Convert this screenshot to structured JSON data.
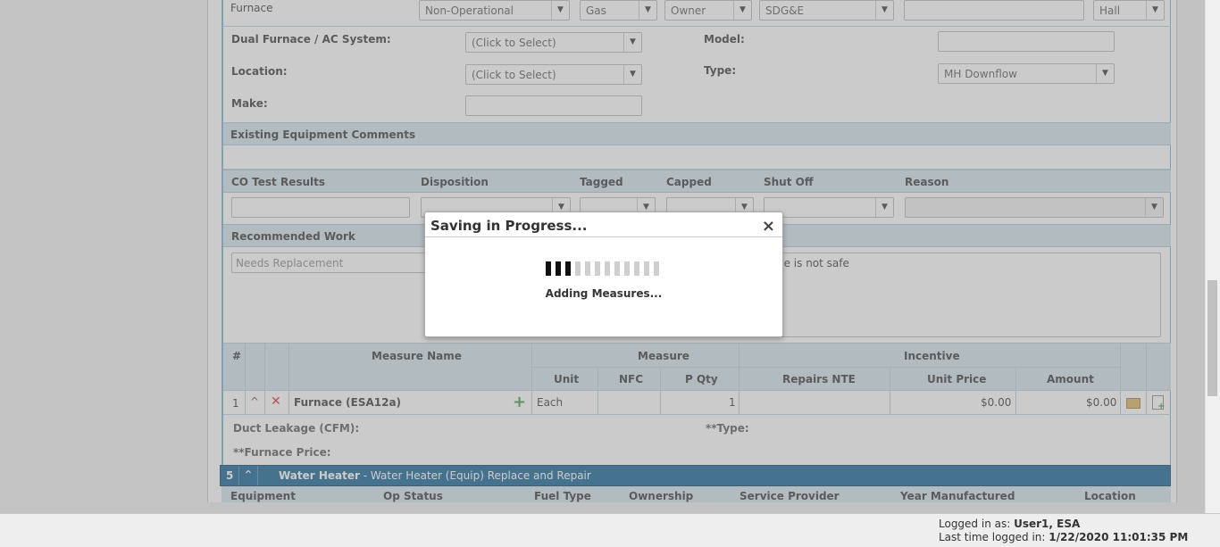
{
  "furnace_row": {
    "equipment": "Furnace",
    "op_status": "Non-Operational",
    "fuel_type": "Gas",
    "ownership": "Owner",
    "provider": "SDG&E",
    "year": "",
    "location": "Hall"
  },
  "details": {
    "dual_label": "Dual Furnace / AC System:",
    "dual_value": "(Click to Select)",
    "model_label": "Model:",
    "model_value": "",
    "location_label": "Location:",
    "location_value": "(Click to Select)",
    "type_label": "Type:",
    "type_value": "MH Downflow",
    "make_label": "Make:",
    "make_value": ""
  },
  "comments": {
    "title": "Existing Equipment Comments"
  },
  "co_test": {
    "headers": [
      "CO Test Results",
      "Disposition",
      "Tagged",
      "Capped",
      "Shut Off",
      "Reason"
    ]
  },
  "recommended": {
    "title": "Recommended Work",
    "placeholder": "Needs Replacement",
    "note": "ce is not safe"
  },
  "measures": {
    "header_num": "#",
    "header_name": "Measure Name",
    "header_measure": "Measure",
    "header_incentive": "Incentive",
    "sub_unit": "Unit",
    "sub_nfc": "NFC",
    "sub_pqty": "P Qty",
    "sub_repairs": "Repairs NTE",
    "sub_unit_price": "Unit Price",
    "sub_amount": "Amount",
    "row": {
      "num": "1",
      "name": "Furnace (ESA12a)",
      "unit": "Each",
      "nfc": "",
      "pqty": "1",
      "repairs": "",
      "unit_price": "$0.00",
      "amount": "$0.00"
    }
  },
  "extra": {
    "duct_label": "Duct Leakage (CFM):",
    "type_label": "**Type:",
    "price_label": "**Furnace Price:"
  },
  "section5": {
    "num": "5",
    "title_bold": "Water Heater",
    "title_rest": " - Water Heater (Equip) Replace and Repair",
    "columns": [
      "Equipment",
      "Op Status",
      "Fuel Type",
      "Ownership",
      "Service Provider",
      "Year Manufactured",
      "Location"
    ]
  },
  "modal": {
    "title": "Saving in Progress...",
    "message": "Adding Measures...",
    "progress_fraction": 0.25
  },
  "footer": {
    "logged_in_label": "Logged in as: ",
    "logged_in_user": "User1, ESA",
    "last_login_label": "Last time logged in: ",
    "last_login_value": "1/22/2020 11:01:35 PM"
  },
  "colors": {
    "header_blue": "#cfe2ec",
    "section_bar": "#0c5e93",
    "add_green": "#3a9b3a",
    "delete_red": "#d22"
  }
}
